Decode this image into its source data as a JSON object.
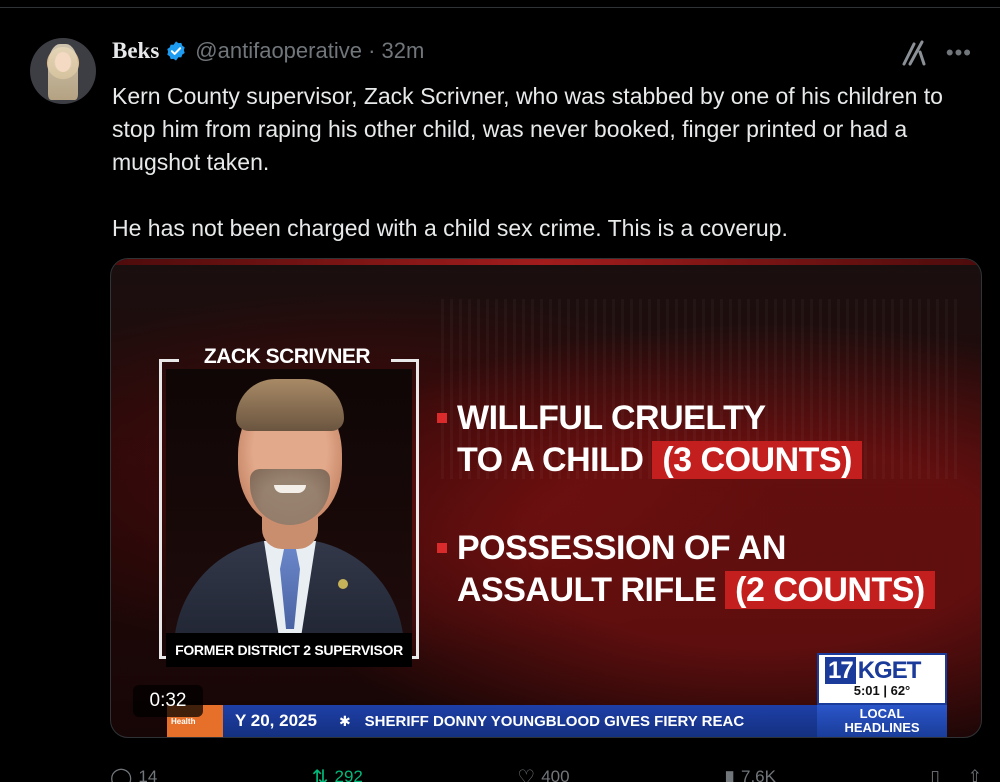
{
  "tweet": {
    "author_name": "Beks",
    "handle_time": "@antifaoperative · 32m",
    "text": "Kern County supervisor, Zack Scrivner, who was stabbed by one of his children to stop him from raping his other child, was never booked, finger printed or had a mugshot taken.\n\nHe has not been charged with a child sex crime. This is a coverup.",
    "accent_color": "#1d9bf0"
  },
  "media": {
    "frame_title": "ZACK SCRIVNER",
    "caption": "FORMER DISTRICT 2 SUPERVISOR",
    "charge1_line1": "WILLFUL CRUELTY",
    "charge1_line2": "TO A CHILD",
    "charge1_count": "(3 COUNTS)",
    "charge2_line1": "POSSESSION OF AN",
    "charge2_line2": "ASSAULT RIFLE",
    "charge2_count": "(2 COUNTS)",
    "logo_num": "17",
    "logo_brand": "KGET",
    "time_temp": "5:01 | 62°",
    "ticker_tag": "Health",
    "ticker_date": "Y 20, 2025",
    "ticker_headline": "SHERIFF DONNY YOUNGBLOOD GIVES FIERY REAC",
    "local_line1": "LOCAL",
    "local_line2": "HEADLINES",
    "video_time": "0:32"
  },
  "actions": {
    "replies": "14",
    "retweets": "292",
    "likes": "400",
    "views": "7.6K"
  }
}
